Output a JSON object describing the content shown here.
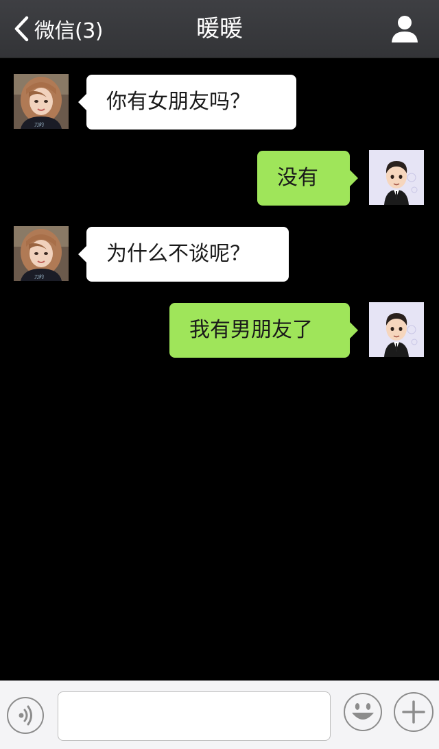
{
  "header": {
    "back_label": "微信(3)",
    "title": "暖暖",
    "back_icon": "chevron-left-icon",
    "profile_icon": "person-icon"
  },
  "messages": [
    {
      "side": "incoming",
      "text": "你有女朋友吗？"
    },
    {
      "side": "outgoing",
      "text": "没有"
    },
    {
      "side": "incoming",
      "text": "为什么不谈呢？"
    },
    {
      "side": "outgoing",
      "text": "我有男朋友了"
    }
  ],
  "input_bar": {
    "voice_icon": "voice-icon",
    "input_value": "",
    "emoji_icon": "emoji-icon",
    "plus_icon": "plus-icon"
  },
  "colors": {
    "header_bg": "#39393c",
    "chat_bg": "#000000",
    "incoming_bubble": "#ffffff",
    "outgoing_bubble": "#9fe55a",
    "input_bar_bg": "#f4f4f6"
  }
}
